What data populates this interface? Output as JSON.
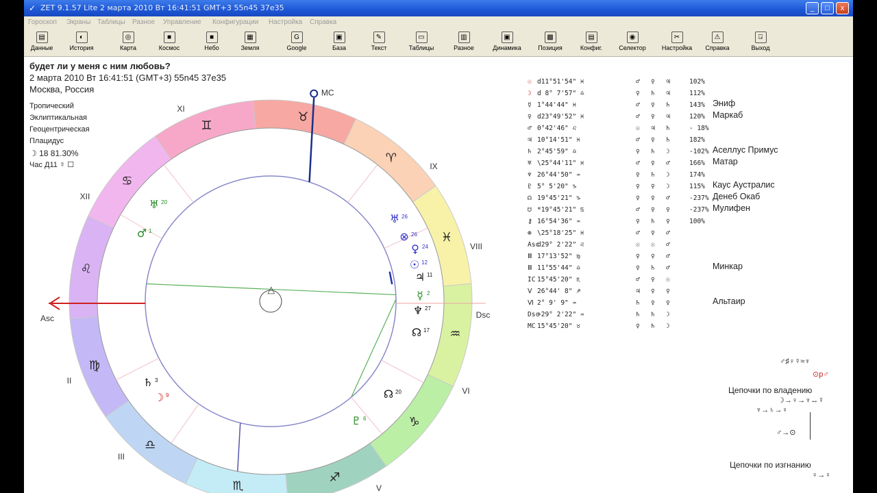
{
  "window": {
    "title": "ZET 9.1.57 Lite    2 марта 2010  Вт  16:41:51 GMT+3 55n45  37e35",
    "minimize_label": "_",
    "maximize_label": "□",
    "close_label": "x"
  },
  "menu": [
    "Гороскоп",
    "Экраны",
    "Таблицы",
    "Разное",
    "Управление",
    "Конфигурации",
    "Настройка",
    "Справка"
  ],
  "toolbar": [
    {
      "label": "Данные",
      "icon": "data-icon",
      "glyph": "▤"
    },
    {
      "label": "История",
      "icon": "history-icon",
      "glyph": "◐"
    },
    {
      "label": "Карта",
      "icon": "chart-map-icon",
      "glyph": "◎"
    },
    {
      "label": "Космос",
      "icon": "cosmos-icon",
      "glyph": "■"
    },
    {
      "label": "Небо",
      "icon": "sky-icon",
      "glyph": "■"
    },
    {
      "label": "Земля",
      "icon": "earth-icon",
      "glyph": "▦"
    },
    {
      "label": "Google",
      "icon": "google-icon",
      "glyph": "G"
    },
    {
      "label": "База",
      "icon": "database-icon",
      "glyph": "▣"
    },
    {
      "label": "Текст",
      "icon": "text-icon",
      "glyph": "✎"
    },
    {
      "label": "Таблицы",
      "icon": "tables-icon",
      "glyph": "▭"
    },
    {
      "label": "Разное",
      "icon": "misc-icon",
      "glyph": "▥"
    },
    {
      "label": "Динамика",
      "icon": "dynamics-icon",
      "glyph": "▣"
    },
    {
      "label": "Позиция",
      "icon": "position-icon",
      "glyph": "▩"
    },
    {
      "label": "Конфиг.",
      "icon": "config-icon",
      "glyph": "▤"
    },
    {
      "label": "Селектор",
      "icon": "selector-icon",
      "glyph": "◉"
    },
    {
      "label": "Настройка",
      "icon": "settings-icon",
      "glyph": "✂"
    },
    {
      "label": "Справка",
      "icon": "help-icon",
      "glyph": "⚠"
    },
    {
      "label": "Выход",
      "icon": "exit-icon",
      "glyph": "⍈"
    }
  ],
  "header": {
    "question": "будет ли у меня с ним любовь?",
    "datetime": "2 марта 2010  Вт  16:41:51 (GMT+3) 55n45  37e35",
    "place": "Москва, Россия"
  },
  "settings": {
    "zodiac": "Тропический",
    "coords": "Эклиптикальная",
    "center": "Геоцентрическая",
    "houses": "Плацидус",
    "moon_day": "☽  18 81.30%",
    "hour": "Час Д11 ☿ ☐"
  },
  "chart": {
    "mc_label": "MC",
    "asc_label": "Asc",
    "dsc_label": "Dsc",
    "houses": [
      "XI",
      "IX",
      "XII",
      "VIII",
      "II",
      "VI",
      "III",
      "V"
    ],
    "signs": [
      "♊",
      "♉",
      "♈",
      "♓",
      "♒",
      "♑",
      "♐",
      "♏",
      "♎",
      "♍",
      "♌",
      "♋"
    ],
    "planets": [
      {
        "glyph": "♅",
        "deg": "20",
        "color": "#1f8a1f"
      },
      {
        "glyph": "♂",
        "deg": "1",
        "color": "#1f8a1f"
      },
      {
        "glyph": "♅",
        "deg": "26",
        "color": "#3030c8"
      },
      {
        "glyph": "⊗",
        "deg": "26",
        "color": "#3030c8"
      },
      {
        "glyph": "♀",
        "deg": "24",
        "color": "#3030c8"
      },
      {
        "glyph": "☉",
        "deg": "12",
        "color": "#3030c8"
      },
      {
        "glyph": "♃",
        "deg": "11",
        "color": "#111"
      },
      {
        "glyph": "☿",
        "deg": "2",
        "color": "#1f8a1f"
      },
      {
        "glyph": "♆",
        "deg": "27",
        "color": "#111"
      },
      {
        "glyph": "☊",
        "deg": "17",
        "color": "#111"
      },
      {
        "glyph": "♄",
        "deg": "3",
        "color": "#111"
      },
      {
        "glyph": "☽",
        "deg": "9",
        "color": "#d02020"
      },
      {
        "glyph": "☊",
        "deg": "20",
        "color": "#111"
      },
      {
        "glyph": "♇",
        "deg": "6",
        "color": "#1f8a1f"
      }
    ],
    "aspect_mark": "△"
  },
  "table": [
    {
      "p": "☉",
      "pos": "d11°51'54\" ♓",
      "a": "♂",
      "b": "♀",
      "c": "♃",
      "pct": "102%",
      "star": ""
    },
    {
      "p": "☽",
      "pos": "d 8° 7'57\" ♎",
      "a": "♀",
      "b": "♄",
      "c": "♃",
      "pct": "112%",
      "star": ""
    },
    {
      "p": "☿",
      "pos": "  1°44'44\" ♓",
      "a": "♂",
      "b": "♀",
      "c": "♄",
      "pct": "143%",
      "star": "Эниф"
    },
    {
      "p": "♀",
      "pos": "d23°49'52\" ♓",
      "a": "♂",
      "b": "♀",
      "c": "♃",
      "pct": "120%",
      "star": "Маркаб"
    },
    {
      "p": "♂",
      "pos": "  0°42'46\" ♌",
      "a": "☉",
      "b": "♃",
      "c": "♄",
      "pct": "- 18%",
      "star": ""
    },
    {
      "p": "♃",
      "pos": " 10°14'51\" ♓",
      "a": "♂",
      "b": "♀",
      "c": "♄",
      "pct": "182%",
      "star": ""
    },
    {
      "p": "♄",
      "pos": "  2°45'59\" ♎",
      "a": "♀",
      "b": "♄",
      "c": "☽",
      "pct": "-102%",
      "star": "Аселлус Примус"
    },
    {
      "p": "♅",
      "pos": "\\25°44'11\" ♓",
      "a": "♂",
      "b": "♀",
      "c": "♂",
      "pct": "166%",
      "star": "Матар"
    },
    {
      "p": "♆",
      "pos": " 26°44'50\" ♒",
      "a": "♀",
      "b": "♄",
      "c": "☽",
      "pct": "174%",
      "star": ""
    },
    {
      "p": "♇",
      "pos": "  5° 5'20\" ♑",
      "a": "♀",
      "b": "♀",
      "c": "☽",
      "pct": "115%",
      "star": "Каус Аустралис"
    },
    {
      "p": "☊",
      "pos": " 19°45'21\" ♑",
      "a": "♀",
      "b": "♀",
      "c": "♂",
      "pct": "-237%",
      "star": "Денеб Окаб"
    },
    {
      "p": "☋",
      "pos": "*19°45'21\" ♋",
      "a": "♂",
      "b": "♀",
      "c": "♀",
      "pct": "-237%",
      "star": "Мулифен"
    },
    {
      "p": "⚷",
      "pos": " 16°54'36\" ♒",
      "a": "♀",
      "b": "♄",
      "c": "♀",
      "pct": "100%",
      "star": ""
    },
    {
      "p": "⊕",
      "pos": "\\25°18'25\" ♓",
      "a": "♂",
      "b": "♀",
      "c": "♂",
      "pct": "",
      "star": ""
    },
    {
      "p": "Asc",
      "pos": "d29° 2'22\" ♌",
      "a": "☉",
      "b": "☉",
      "c": "♂",
      "pct": "",
      "star": ""
    },
    {
      "p": "Ⅲ",
      "pos": " 17°13'52\" ♍",
      "a": "♀",
      "b": "♀",
      "c": "♂",
      "pct": "",
      "star": ""
    },
    {
      "p": "Ⅲ",
      "pos": " 11°55'44\" ♎",
      "a": "♀",
      "b": "♄",
      "c": "♂",
      "pct": "",
      "star": "Минкар"
    },
    {
      "p": "IC",
      "pos": " 15°45'20\" ♏",
      "a": "♂",
      "b": "♀",
      "c": "☉",
      "pct": "",
      "star": ""
    },
    {
      "p": "Ⅴ",
      "pos": " 26°44' 8\" ♐",
      "a": "♃",
      "b": "♀",
      "c": "♀",
      "pct": "",
      "star": ""
    },
    {
      "p": "Ⅵ",
      "pos": "  2° 9' 9\" ♒",
      "a": "♄",
      "b": "♀",
      "c": "♀",
      "pct": "",
      "star": "Альтаир"
    },
    {
      "p": "Dsc",
      "pos": "+29° 2'22\" ♒",
      "a": "♄",
      "b": "♄",
      "c": "☽",
      "pct": "",
      "star": ""
    },
    {
      "p": "MC",
      "pos": " 15°45'20\" ♉",
      "a": "♀",
      "b": "♄",
      "c": "☽",
      "pct": "",
      "star": ""
    }
  ],
  "right_panel": {
    "line1": "♂♯♀☿≈♆",
    "line2": "⊙p♂",
    "chains_owner_title": "Цепочки по владению",
    "chain1": "☽→♀→♆↔☿",
    "chain2": "♆→♄→♀",
    "chain3": "♂→⊙",
    "chains_exile_title": "Цепочки по изгнанию",
    "chain4": "♀→♀"
  },
  "colors": {
    "title_bar": "#1d57d6",
    "toolbar_bg": "#ece9d8",
    "asc_arrow": "#d02020",
    "mc_line": "#1a2e8a",
    "signs": [
      "#f7f2a8",
      "#fbd2b6",
      "#f7a8a2",
      "#f7a8c8",
      "#f2b6ee",
      "#d9b3f4",
      "#c4b8f6",
      "#bed6f4",
      "#c3ecf6",
      "#9fd3bf",
      "#bbefa5",
      "#d9f2a2"
    ]
  }
}
